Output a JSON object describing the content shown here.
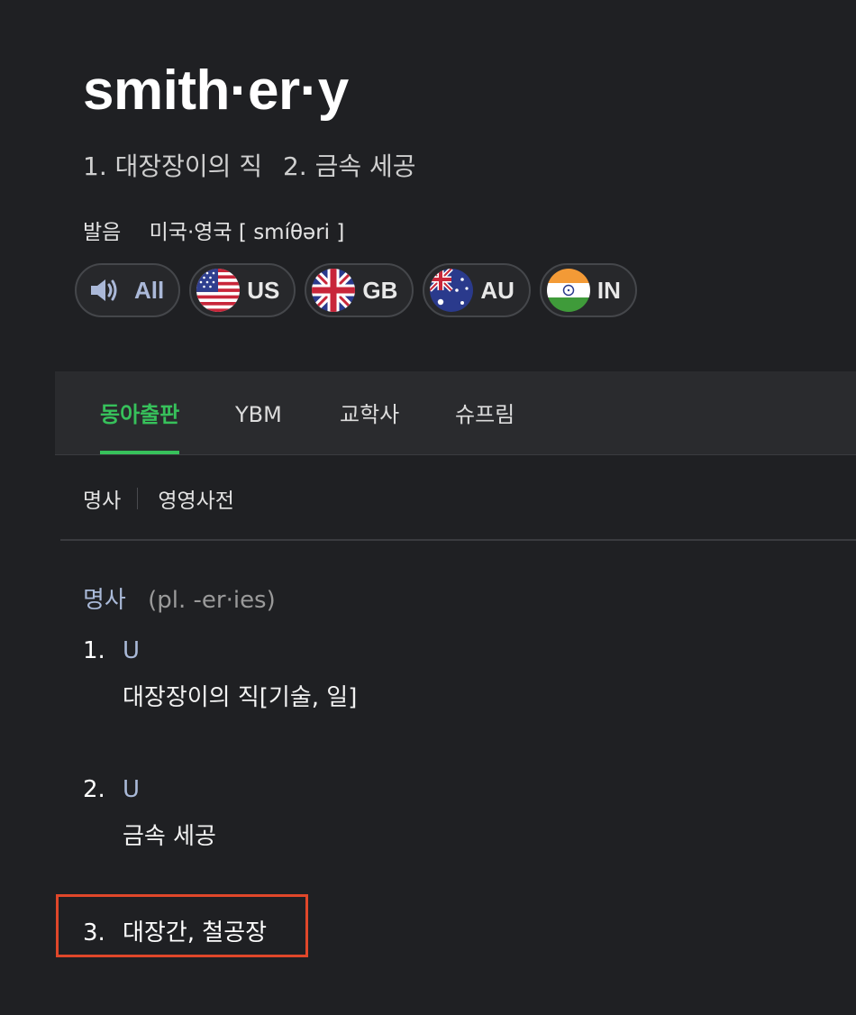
{
  "entry": {
    "headword": "smith·er·y",
    "summary": [
      "1. 대장장이의 직",
      "2. 금속 세공"
    ]
  },
  "pronunciation": {
    "label": "발음",
    "region": "미국·영국",
    "ipa": "[ smíθəri ]"
  },
  "audio_buttons": [
    {
      "label": "All",
      "icon": "speaker-icon"
    },
    {
      "label": "US",
      "icon": "us-flag-icon"
    },
    {
      "label": "GB",
      "icon": "gb-flag-icon"
    },
    {
      "label": "AU",
      "icon": "au-flag-icon"
    },
    {
      "label": "IN",
      "icon": "in-flag-icon"
    }
  ],
  "dictionary_tabs": [
    {
      "label": "동아출판",
      "active": true
    },
    {
      "label": "YBM",
      "active": false
    },
    {
      "label": "교학사",
      "active": false
    },
    {
      "label": "슈프림",
      "active": false
    }
  ],
  "sub_tabs": [
    "명사",
    "영영사전"
  ],
  "definitions": {
    "part_of_speech": "명사",
    "plural_note": "(pl. -er·ies)",
    "senses": [
      {
        "number": "1.",
        "grammar": "U",
        "text": "대장장이의 직[기술, 일]"
      },
      {
        "number": "2.",
        "grammar": "U",
        "text": "금속 세공"
      },
      {
        "number": "3.",
        "grammar": "",
        "text": "대장간, 철공장"
      }
    ]
  },
  "colors": {
    "background": "#1f2023",
    "tab_active": "#37c15b",
    "grammar_label": "#a9b9d8",
    "highlight": "#e0472a"
  }
}
